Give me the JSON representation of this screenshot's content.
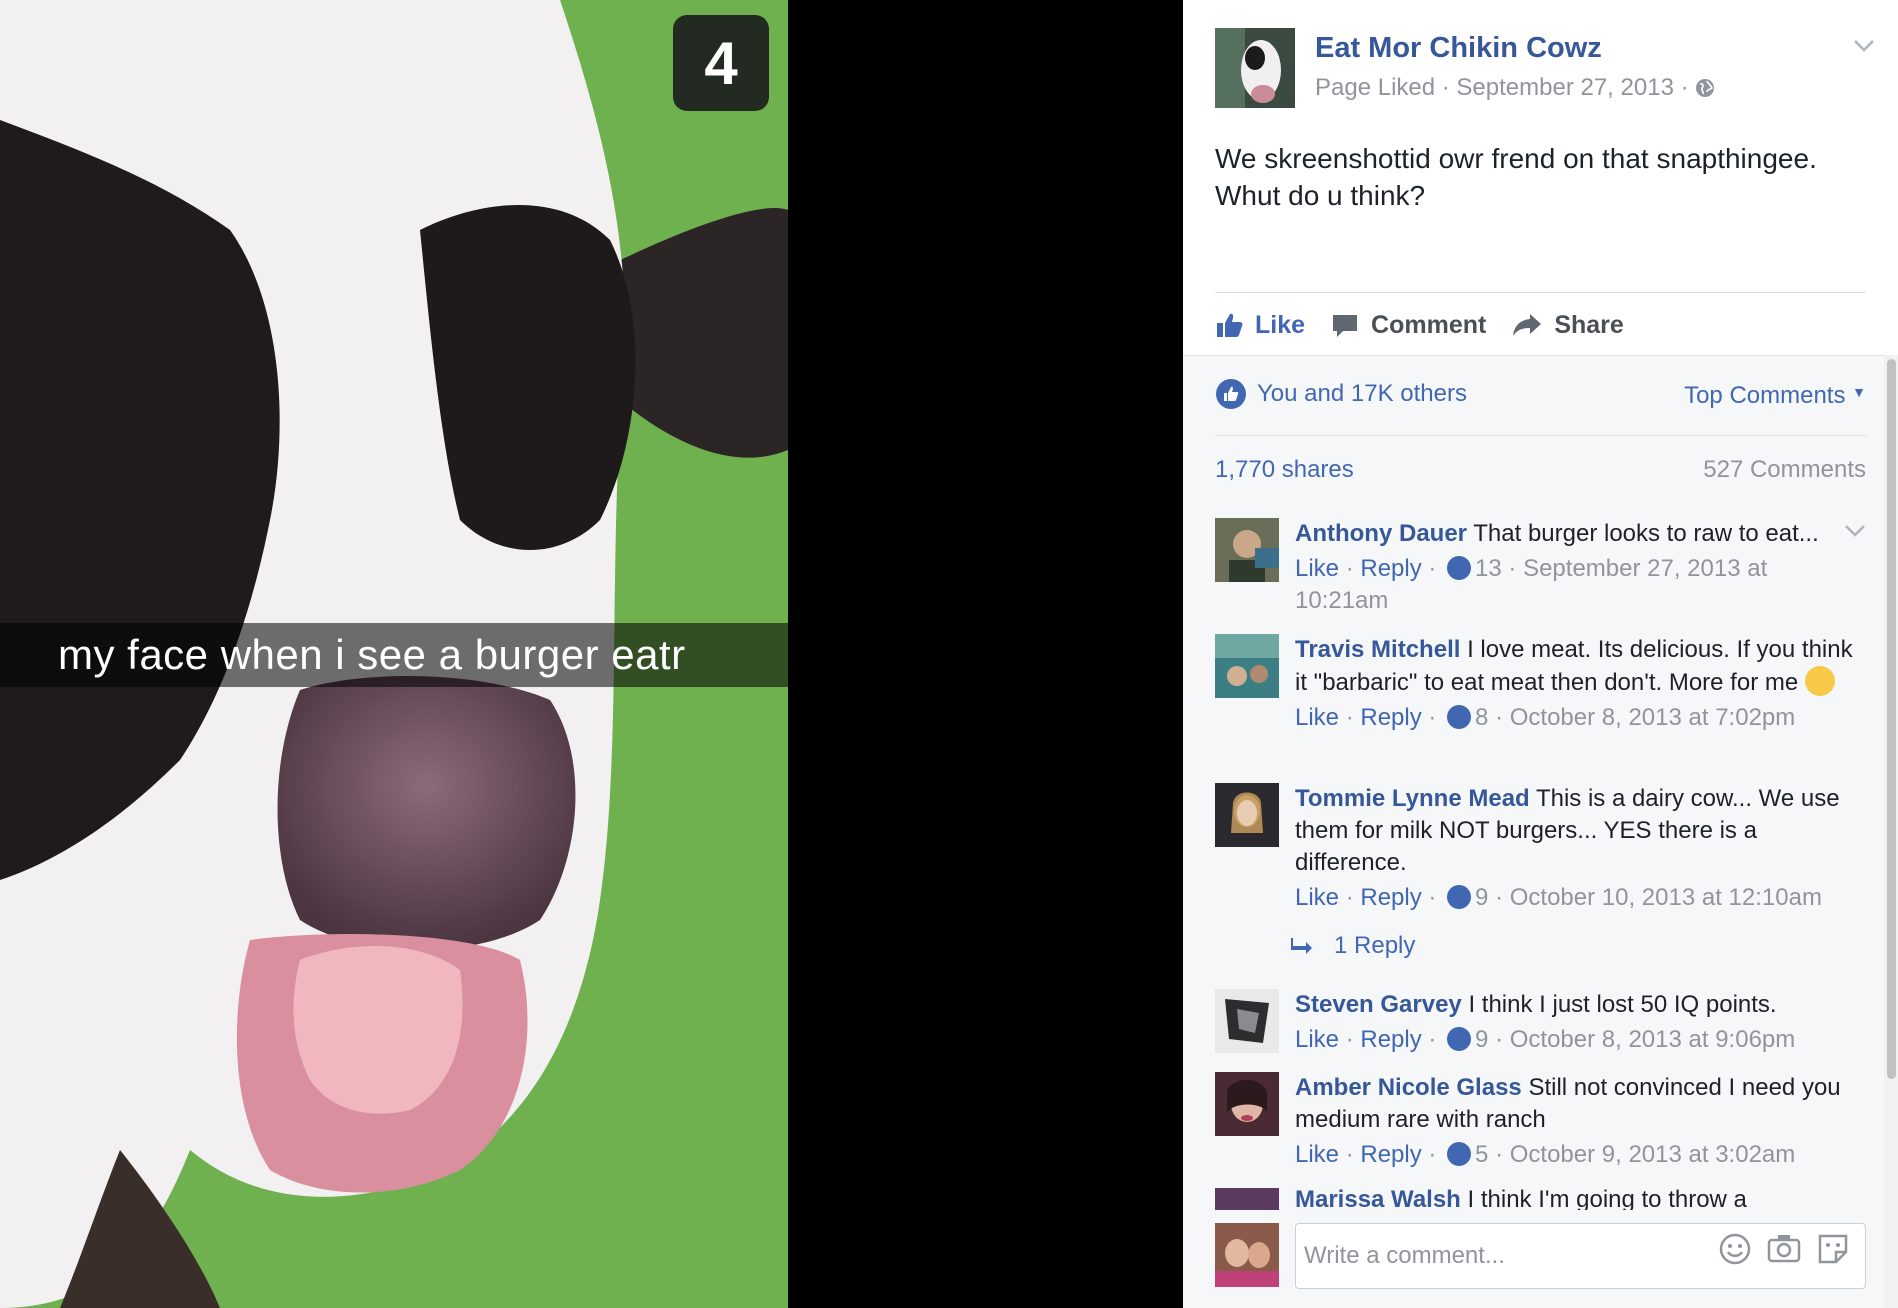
{
  "photo": {
    "timer": "4",
    "caption": "my face when i see a burger eatr"
  },
  "post": {
    "page_name": "Eat Mor Chikin Cowz",
    "meta": "Page Liked · September 27, 2013 ·",
    "text": "We skreenshottid owr frend on that snapthingee. Whut do u think?",
    "actions": {
      "like": "Like",
      "comment": "Comment",
      "share": "Share"
    },
    "reactions": "You and 17K others",
    "top_comments": "Top Comments",
    "shares": "1,770 shares",
    "comment_count": "527 Comments"
  },
  "comments": [
    {
      "name": "Anthony Dauer",
      "text": "That burger looks to raw to eat...",
      "like": "Like",
      "reply": "Reply",
      "likes": "13",
      "time": "September 27, 2013 at 10:21am"
    },
    {
      "name": "Travis Mitchell",
      "text": "I love meat. Its delicious. If you think it \"barbaric\" to eat meat then don't. More for me",
      "like": "Like",
      "reply": "Reply",
      "likes": "8",
      "time": "October 8, 2013 at 7:02pm"
    },
    {
      "name": "Tommie Lynne Mead",
      "text": "This is a dairy cow... We use them for milk NOT burgers... YES there is a difference.",
      "like": "Like",
      "reply": "Reply",
      "likes": "9",
      "time": "October 10, 2013 at 12:10am"
    },
    {
      "name": "Steven Garvey",
      "text": "I think I just lost 50 IQ points.",
      "like": "Like",
      "reply": "Reply",
      "likes": "9",
      "time": "October 8, 2013 at 9:06pm"
    },
    {
      "name": "Amber Nicole Glass",
      "text": "Still not convinced I need you medium rare with ranch",
      "like": "Like",
      "reply": "Reply",
      "likes": "5",
      "time": "October 9, 2013 at 3:02am"
    },
    {
      "name": "Marissa Walsh",
      "text": "I think I'm going to throw a"
    }
  ],
  "replies_link": "1 Reply",
  "composer": {
    "placeholder": "Write a comment..."
  },
  "colors": {
    "link": "#365899",
    "accent": "#4267b2",
    "muted": "#90949c"
  },
  "icons": [
    "thumbs-up-icon",
    "comment-bubble-icon",
    "share-arrow-icon",
    "globe-icon",
    "chevron-down-icon",
    "smiley-icon",
    "camera-icon",
    "sticker-icon",
    "reply-arrow-icon"
  ]
}
